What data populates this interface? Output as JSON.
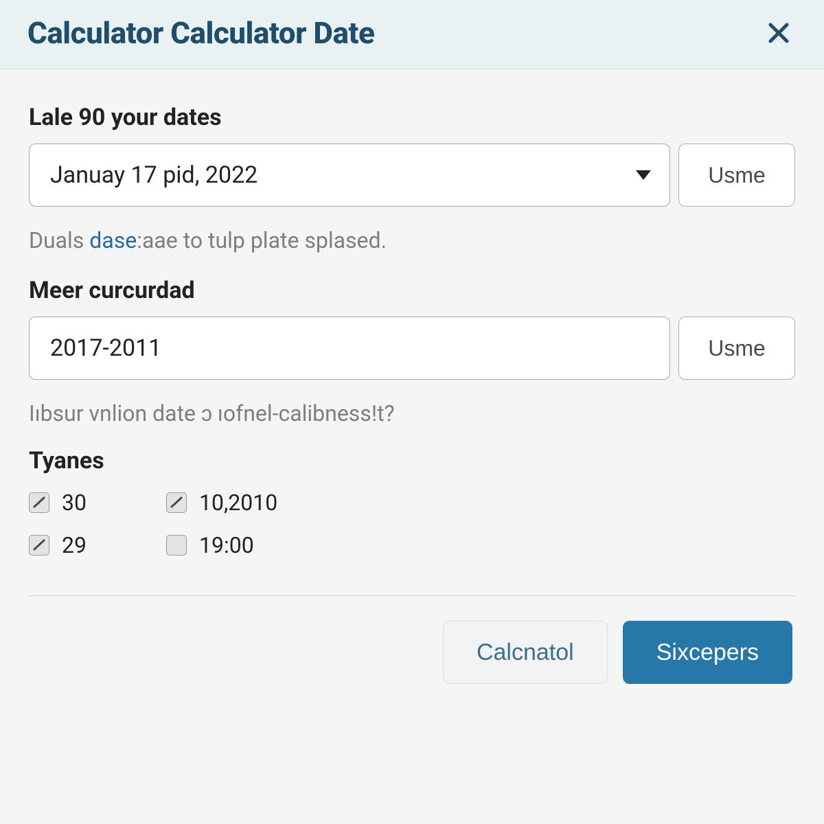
{
  "header": {
    "title": "Calculator Calculator Date"
  },
  "fields": {
    "dates": {
      "label": "Lale 90 your dates",
      "select_value": "Januay 17 pid, 2022",
      "side_button": "Usme",
      "help_pre": "Duals ",
      "help_link": "dase",
      "help_post": ":aae to tulp plate splased."
    },
    "curcurdad": {
      "label": "Meer curcurdad",
      "value": "2017-2011",
      "side_button": "Usme",
      "help": "Iıbsur vnlion date ɔ ıofnel-calibness!t?"
    },
    "tyanes": {
      "label": "Tyanes",
      "items": [
        {
          "label": "30",
          "checked": true
        },
        {
          "label": "10,2010",
          "checked": true
        },
        {
          "label": "29",
          "checked": true
        },
        {
          "label": "19:00",
          "checked": false
        }
      ]
    }
  },
  "footer": {
    "secondary": "Calcnatol",
    "primary": "Sixcepers"
  }
}
